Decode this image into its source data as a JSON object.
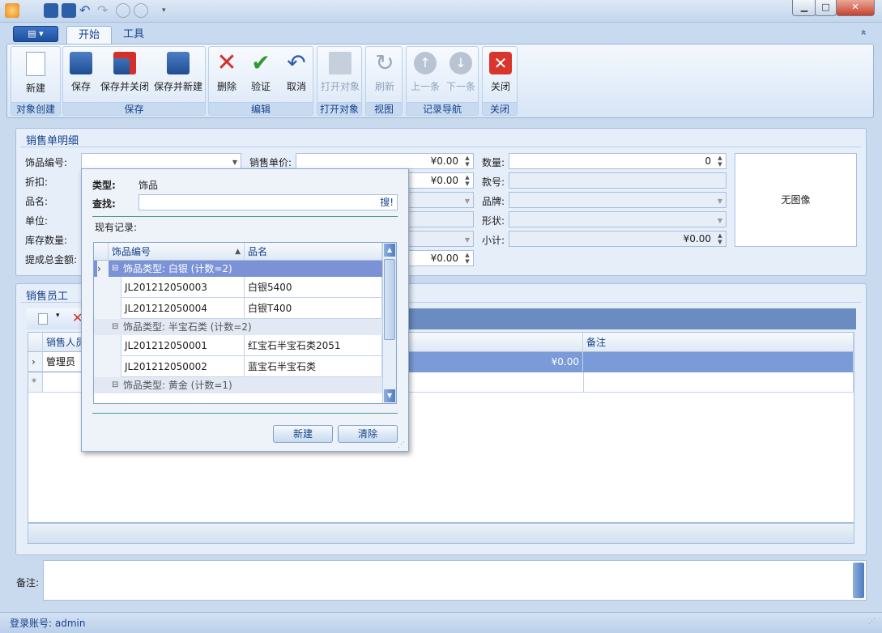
{
  "window": {
    "min": "▁",
    "max": "□",
    "close": "✕"
  },
  "ribbon": {
    "app_menu": "▤ ▾",
    "tabs": [
      {
        "label": "开始"
      },
      {
        "label": "工具"
      }
    ],
    "collapse": "«",
    "groups": {
      "create": "对象创建",
      "save": "保存",
      "edit": "编辑",
      "open": "打开对象",
      "view": "视图",
      "nav": "记录导航",
      "close": "关闭"
    },
    "buttons": {
      "new": "新建",
      "save": "保存",
      "save_close": "保存并关闭",
      "save_new": "保存并新建",
      "delete": "删除",
      "validate": "验证",
      "cancel": "取消",
      "open": "打开对象",
      "refresh": "刷新",
      "prev": "上一条",
      "next": "下一条",
      "close": "关闭"
    }
  },
  "detail": {
    "title": "销售单明细",
    "labels": {
      "code": "饰品编号:",
      "unit_price": "销售单价:",
      "qty": "数量:",
      "discount": "折扣:",
      "style_no": "款号:",
      "name": "品名:",
      "brand": "品牌:",
      "unit": "单位:",
      "shape": "形状:",
      "stock": "库存数量:",
      "subtotal": "小计:",
      "commission": "提成总金额:"
    },
    "values": {
      "unit_price": "¥0.00",
      "qty": "0",
      "discount": "¥0.00",
      "subtotal": "¥0.00",
      "commission": "¥0.00"
    },
    "no_image": "无图像"
  },
  "staff": {
    "title": "销售员工",
    "columns": [
      "销售人员",
      "备注"
    ],
    "rows": [
      {
        "name": "管理员",
        "amount": "¥0.00"
      }
    ],
    "new_row": "*"
  },
  "popup": {
    "type_label": "类型:",
    "type_value": "饰品",
    "search_label": "查找:",
    "search_btn": "搜!",
    "records_label": "现有记录:",
    "columns": [
      "饰品编号",
      "品名"
    ],
    "groups": [
      {
        "header": "饰品类型: 白银 (计数=2)",
        "rows": [
          {
            "code": "JL201212050003",
            "name": "白银5400"
          },
          {
            "code": "JL201212050004",
            "name": "白银T400"
          }
        ]
      },
      {
        "header": "饰品类型: 半宝石类 (计数=2)",
        "rows": [
          {
            "code": "JL201212050001",
            "name": "红宝石半宝石类2051"
          },
          {
            "code": "JL201212050002",
            "name": "蓝宝石半宝石类"
          }
        ]
      },
      {
        "header": "饰品类型: 黄金 (计数=1)",
        "rows": []
      }
    ],
    "btn_new": "新建",
    "btn_clear": "清除"
  },
  "remark_label": "备注:",
  "status": "登录账号: admin",
  "colors": {
    "accent": "#15428b",
    "selected_row": "#7b9bd8",
    "group_selected": "#7b93d6"
  }
}
